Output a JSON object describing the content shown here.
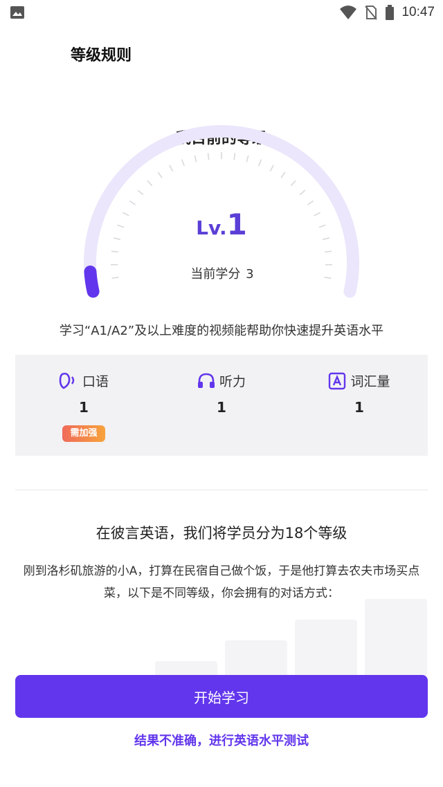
{
  "status_bar": {
    "time": "10:47",
    "icons": [
      "image-icon",
      "wifi-icon",
      "no-sim-icon",
      "battery-icon"
    ]
  },
  "header": {
    "title": "等级规则"
  },
  "level": {
    "title": "我目前的等级",
    "prefix": "Lv.",
    "number": "1",
    "credit_label": "当前学分",
    "credit_value": "3",
    "progress_fraction": 0.02
  },
  "hint": "学习“A1/A2”及以上难度的视频能帮助你快速提升英语水平",
  "stats": [
    {
      "icon": "speech-icon",
      "label": "口语",
      "value": "1",
      "badge": "需加强"
    },
    {
      "icon": "headphones-icon",
      "label": "听力",
      "value": "1"
    },
    {
      "icon": "vocabulary-icon",
      "label": "词汇量",
      "value": "1"
    }
  ],
  "info": {
    "title": "在彼言英语，我们将学员分为18个等级",
    "description": "刚到洛杉矶旅游的小A，打算在民宿自己做个饭，于是他打算去农夫市场买点菜，以下是不同等级，你会拥有的对话方式："
  },
  "actions": {
    "start_label": "开始学习",
    "retest_label": "结果不准确，进行英语水平测试"
  },
  "colors": {
    "accent": "#6236ec",
    "gauge_track": "#ebe6fb",
    "card_bg": "#f2f2f4",
    "badge_gradient": [
      "#f06a5a",
      "#f7a33c"
    ]
  }
}
